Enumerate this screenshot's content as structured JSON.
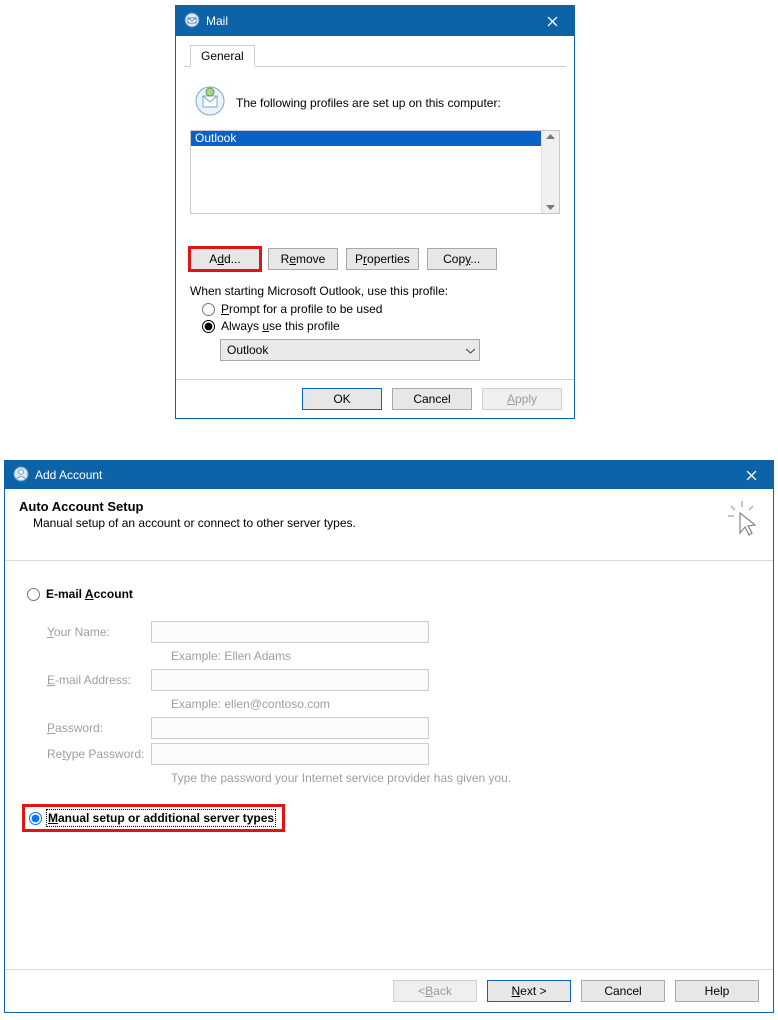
{
  "mail": {
    "title": "Mail",
    "tab": "General",
    "info": "The following profiles are set up on this computer:",
    "profiles": [
      "Outlook"
    ],
    "buttons": {
      "add": "Add...",
      "remove": "Remove",
      "properties": "Properties",
      "copy": "Copy..."
    },
    "startup_label": "When starting Microsoft Outlook, use this profile:",
    "radio_prompt": "Prompt for a profile to be used",
    "radio_always": "Always use this profile",
    "selected_profile": "Outlook",
    "footer": {
      "ok": "OK",
      "cancel": "Cancel",
      "apply": "Apply"
    }
  },
  "add": {
    "title": "Add Account",
    "header_title": "Auto Account Setup",
    "header_sub": "Manual setup of an account or connect to other server types.",
    "opt_email": "E-mail Account",
    "fields": {
      "name": "Your Name:",
      "name_hint": "Example: Ellen Adams",
      "email": "E-mail Address:",
      "email_hint": "Example: ellen@contoso.com",
      "pw": "Password:",
      "pw2": "Retype Password:",
      "pw_hint": "Type the password your Internet service provider has given you."
    },
    "opt_manual": "Manual setup or additional server types",
    "footer": {
      "back": "< Back",
      "next": "Next >",
      "cancel": "Cancel",
      "help": "Help"
    }
  }
}
